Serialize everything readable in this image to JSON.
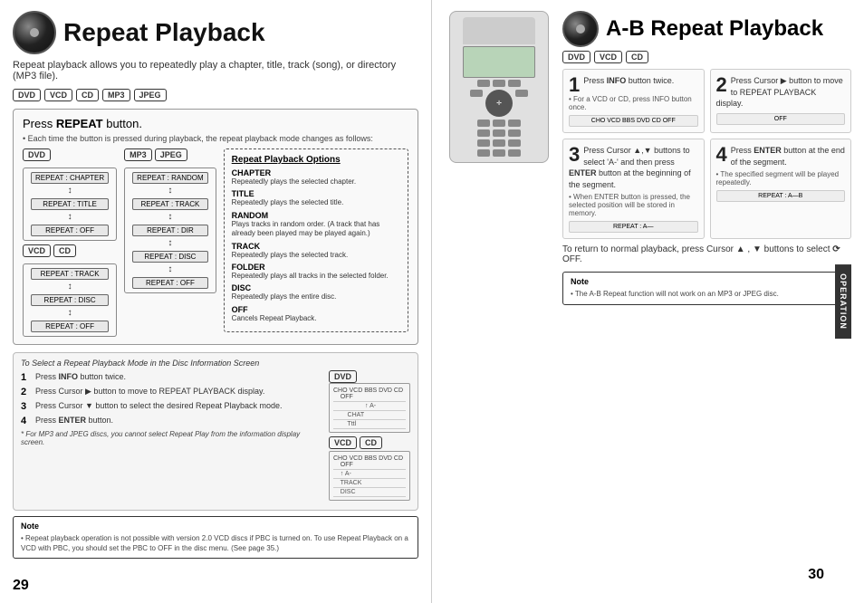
{
  "left": {
    "title": "Repeat Playback",
    "subtitle": "Repeat playback allows you to repeatedly play a chapter, title, track (song), or directory (MP3 file).",
    "formats": [
      "DVD",
      "VCD",
      "CD",
      "MP3",
      "JPEG"
    ],
    "pressRepeat": {
      "title": "Press ",
      "titleBold": "REPEAT",
      "titleEnd": " button.",
      "desc": "• Each time the button is pressed during playback, the repeat playback mode changes as follows:"
    },
    "dvdItems": [
      "REPEAT : CHAPTER",
      "REPEAT : TITLE",
      "REPEAT : OFF"
    ],
    "vcdItems": [
      "REPEAT : TRACK",
      "REPEAT : DISC",
      "REPEAT : OFF"
    ],
    "mp3Items": [
      "REPEAT : RANDOM",
      "REPEAT : TRACK",
      "REPEAT : DIR",
      "REPEAT : DISC",
      "REPEAT : OFF"
    ],
    "mp3Formats": [
      "MP3",
      "JPEG"
    ],
    "dvdFormat": "DVD",
    "vcdFormat": "VCD",
    "cdFormat": "CD",
    "optionsTitle": "Repeat Playback Options",
    "options": [
      {
        "name": "CHAPTER",
        "desc": "Repeatedly plays the selected chapter."
      },
      {
        "name": "TITLE",
        "desc": "Repeatedly plays the selected title."
      },
      {
        "name": "RANDOM",
        "desc": "Plays tracks in random order. (A track that has already been played may be played again.)"
      },
      {
        "name": "TRACK",
        "desc": "Repeatedly plays the selected track."
      },
      {
        "name": "FOLDER",
        "desc": "Repeatedly plays all tracks in the selected folder."
      },
      {
        "name": "DISC",
        "desc": "Repeatedly plays the entire disc."
      },
      {
        "name": "OFF",
        "desc": "Cancels Repeat Playback."
      }
    ],
    "selectSection": {
      "title": "To Select a Repeat Playback Mode in the Disc Information Screen",
      "steps": [
        {
          "num": "1",
          "text": "Press ",
          "bold": "INFO",
          "end": " button twice."
        },
        {
          "num": "2",
          "text": "Press Cursor ▶ button to move to REPEAT PLAYBACK display."
        },
        {
          "num": "3",
          "text": "Press Cursor ▼ button to select the desired Repeat Playback mode."
        },
        {
          "num": "4",
          "text": "Press ",
          "bold": "ENTER",
          "end": " button."
        }
      ],
      "selectNote": "* For MP3 and JPEG discs, you cannot select Repeat Play from the information display screen."
    },
    "noteTitle": "Note",
    "noteText": "• Repeat playback operation is not possible with version 2.0 VCD discs if PBC is turned on. To use Repeat Playback on a VCD with PBC, you should set the PBC to OFF in the disc menu. (See page 35.)",
    "pageNumber": "29"
  },
  "right": {
    "title": "A-B Repeat Playback",
    "formats": [
      "DVD",
      "VCD",
      "CD"
    ],
    "steps": [
      {
        "num": "1",
        "text": "Press ",
        "bold": "INFO",
        "text2": " button twice.",
        "note": "• For a VCD or CD, press INFO button once.",
        "display": "CHO VCD BBS DVD CD OFF"
      },
      {
        "num": "2",
        "text": "Press Cursor ▶ button to move to REPEAT PLAYBACK display.",
        "display": "OFF"
      },
      {
        "num": "3",
        "text": "Press Cursor ▲,▼ buttons to select 'A-' and then press ",
        "bold": "ENTER",
        "text2": " button at the beginning of the segment.",
        "note": "• When ENTER button is pressed, the selected position will be stored in memory.",
        "display": "REPEAT : A—"
      },
      {
        "num": "4",
        "text": "Press ",
        "bold": "ENTER",
        "text2": " button at the end of the segment.",
        "note": "• The specified segment will be played repeatedly.",
        "display": "REPEAT : A—B"
      }
    ],
    "returnNote": "To return to normal playback, press Cursor ▲ , ▼ buttons to select ",
    "returnIcon": "⟳",
    "returnEnd": " OFF.",
    "noteTitle": "Note",
    "noteText": "• The A-B Repeat function will not work on an MP3 or JPEG disc.",
    "operationLabel": "OPERATION",
    "pageNumber": "30"
  }
}
